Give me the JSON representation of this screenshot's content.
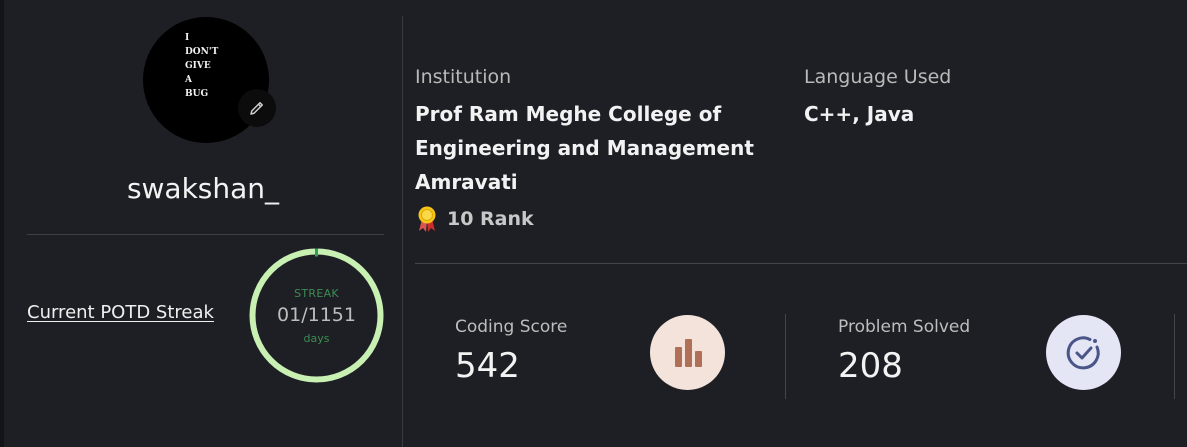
{
  "profile": {
    "username": "swakshan_",
    "avatar_text": "I\nDON'T\nGIVE\nA\nBUG",
    "edit_icon": "pencil-icon"
  },
  "streak": {
    "link_label": "Current POTD Streak",
    "label": "STREAK",
    "value": "01/1151",
    "unit": "days",
    "progress": 0.0009,
    "ring_color": "#c9f0b3",
    "tick_color": "#2f9e5a"
  },
  "info": {
    "institution_label": "Institution",
    "institution_line1": "Prof Ram Meghe College of",
    "institution_line2": "Engineering and Management",
    "institution_line3": "Amravati",
    "rank_icon": "medal-icon",
    "rank_text": "10 Rank",
    "language_label": "Language Used",
    "language_value": "C++, Java"
  },
  "stats": {
    "coding_score_label": "Coding Score",
    "coding_score_value": "542",
    "coding_icon": "bar-chart-icon",
    "problems_label": "Problem Solved",
    "problems_value": "208",
    "problems_icon": "check-circle-icon"
  }
}
